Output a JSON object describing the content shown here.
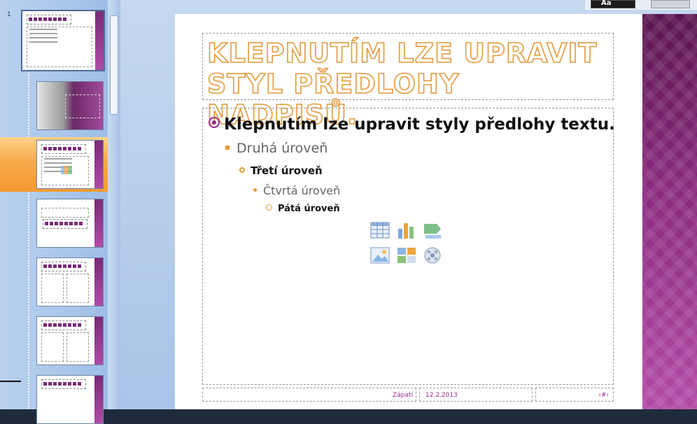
{
  "thumbnails": {
    "first_slide_number": "1",
    "selected_index": 2
  },
  "slide": {
    "title": "Klepnutím lze upravit styl předlohy nadpisů.",
    "levels": [
      "Klepnutím lze upravit styly předlohy textu.",
      "Druhá úroveň",
      "Třetí úroveň",
      "Čtvrtá úroveň",
      "Pátá úroveň"
    ],
    "content_icons": [
      "insert-table-icon",
      "insert-chart-icon",
      "insert-smartart-icon",
      "insert-picture-icon",
      "insert-clipart-icon",
      "insert-media-icon"
    ],
    "footer": {
      "text": "Zápatí",
      "date": "12.2.2013",
      "slide_number": "‹#›"
    }
  },
  "ribbon": {
    "style_label": "Aa"
  },
  "colors": {
    "accent_purple": "#9b2a8f",
    "accent_orange": "#e89a33",
    "selection_orange": "#f59a2e",
    "pane_blue": "#a9c6ea"
  }
}
